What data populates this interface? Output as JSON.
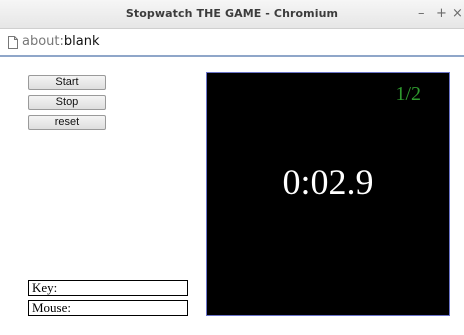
{
  "window": {
    "title": "Stopwatch THE GAME - Chromium",
    "controls": {
      "minimize": "–",
      "maximize": "+",
      "close": "×"
    }
  },
  "address_bar": {
    "icon": "page-icon",
    "scheme": "about:",
    "host": "blank"
  },
  "controls": {
    "start_label": "Start",
    "stop_label": "Stop",
    "reset_label": "reset"
  },
  "fields": {
    "key_label": "Key:",
    "mouse_label": "Mouse:"
  },
  "game": {
    "level": "1/2",
    "timer": "0:02.9",
    "colors": {
      "background": "#000000",
      "level": "#2e9a2e",
      "timer": "#ffffff"
    }
  }
}
